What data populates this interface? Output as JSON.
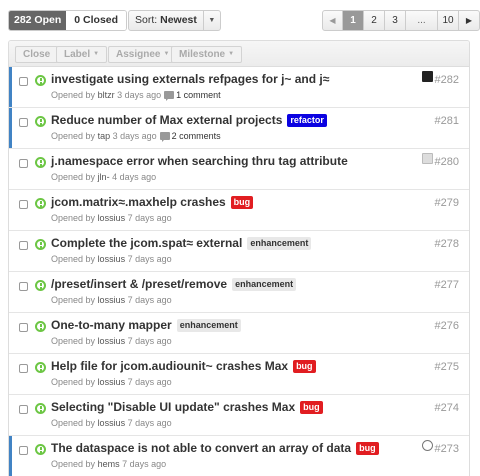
{
  "toolbar": {
    "open_label": "282 Open",
    "closed_label": "0 Closed",
    "sort_prefix": "Sort:",
    "sort_value": "Newest",
    "pages": [
      "1",
      "2",
      "3",
      "...",
      "10"
    ],
    "active_page": "1"
  },
  "actions": {
    "close": "Close",
    "label": "Label",
    "assignee": "Assignee",
    "milestone": "Milestone"
  },
  "colors": {
    "open_status": "#6cc644",
    "unread_marker": "#4183c4",
    "label_refactor": "#0b02e1",
    "label_bug": "#e11d21",
    "label_enhancement": "#e8e8e8"
  },
  "issues": [
    {
      "title": "investigate using externals refpages for j~ and j≈",
      "label": "",
      "opened_by_prefix": "Opened by",
      "user": "bltzr",
      "time": "3 days ago",
      "comments": "1 comment",
      "number": "#282",
      "unread": true,
      "avatar": "dark"
    },
    {
      "title": "Reduce number of Max external projects",
      "label": "refactor",
      "opened_by_prefix": "Opened by",
      "user": "tap",
      "time": "3 days ago",
      "comments": "2 comments",
      "number": "#281",
      "unread": true,
      "avatar": ""
    },
    {
      "title": "j.namespace error when searching thru tag attribute",
      "label": "",
      "opened_by_prefix": "Opened by",
      "user": "jln-",
      "time": "4 days ago",
      "comments": "",
      "number": "#280",
      "unread": false,
      "avatar": "light"
    },
    {
      "title": "jcom.matrix≈.maxhelp crashes",
      "label": "bug",
      "opened_by_prefix": "Opened by",
      "user": "lossius",
      "time": "7 days ago",
      "comments": "",
      "number": "#279",
      "unread": false,
      "avatar": ""
    },
    {
      "title": "Complete the jcom.spat≈ external",
      "label": "enhancement",
      "opened_by_prefix": "Opened by",
      "user": "lossius",
      "time": "7 days ago",
      "comments": "",
      "number": "#278",
      "unread": false,
      "avatar": ""
    },
    {
      "title": "/preset/insert & /preset/remove",
      "label": "enhancement",
      "opened_by_prefix": "Opened by",
      "user": "lossius",
      "time": "7 days ago",
      "comments": "",
      "number": "#277",
      "unread": false,
      "avatar": ""
    },
    {
      "title": "One-to-many mapper",
      "label": "enhancement",
      "opened_by_prefix": "Opened by",
      "user": "lossius",
      "time": "7 days ago",
      "comments": "",
      "number": "#276",
      "unread": false,
      "avatar": ""
    },
    {
      "title": "Help file for jcom.audiounit~ crashes Max",
      "label": "bug",
      "opened_by_prefix": "Opened by",
      "user": "lossius",
      "time": "7 days ago",
      "comments": "",
      "number": "#275",
      "unread": false,
      "avatar": ""
    },
    {
      "title": "Selecting \"Disable UI update\" crashes Max",
      "label": "bug",
      "opened_by_prefix": "Opened by",
      "user": "lossius",
      "time": "7 days ago",
      "comments": "",
      "number": "#274",
      "unread": false,
      "avatar": ""
    },
    {
      "title": "The dataspace is not able to convert an array of data",
      "label": "bug",
      "opened_by_prefix": "Opened by",
      "user": "hems",
      "time": "7 days ago",
      "comments": "",
      "number": "#273",
      "unread": true,
      "avatar": "face"
    }
  ]
}
